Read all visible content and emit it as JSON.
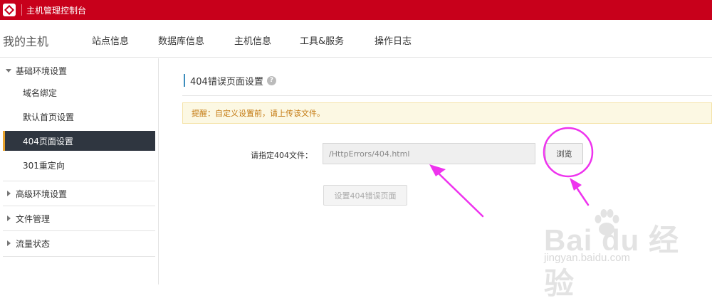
{
  "app": {
    "title": "主机管理控制台"
  },
  "nav": {
    "brand": "我的主机",
    "items": [
      "站点信息",
      "数据库信息",
      "主机信息",
      "工具&服务",
      "操作日志"
    ]
  },
  "sidebar": {
    "groups": [
      {
        "label": "基础环境设置",
        "expanded": true,
        "items": [
          "域名绑定",
          "默认首页设置",
          "404页面设置",
          "301重定向"
        ],
        "active": "404页面设置"
      },
      {
        "label": "高级环境设置",
        "expanded": false
      },
      {
        "label": "文件管理",
        "expanded": false
      },
      {
        "label": "流量状态",
        "expanded": false
      }
    ]
  },
  "main": {
    "section_title": "404错误页面设置",
    "notice": "提醒：自定义设置前，请上传该文件。",
    "field_label": "请指定404文件：",
    "file_value": "/HttpErrors/404.html",
    "browse_label": "浏览",
    "submit_label": "设置404错误页面"
  },
  "watermark": {
    "main": "Bai du 经验",
    "sub": "jingyan.baidu.com"
  },
  "colors": {
    "brand_red": "#c8001b",
    "sidebar_active_bg": "#2f3640",
    "sidebar_active_accent": "#e8a22c",
    "annotation": "#ee33ee",
    "notice_bg": "#fcf8e3",
    "notice_text": "#c47a12"
  },
  "icons": {
    "logo": "brand-logo-icon",
    "help": "question-mark-icon",
    "expanded": "caret-down-icon",
    "collapsed": "caret-right-icon"
  }
}
